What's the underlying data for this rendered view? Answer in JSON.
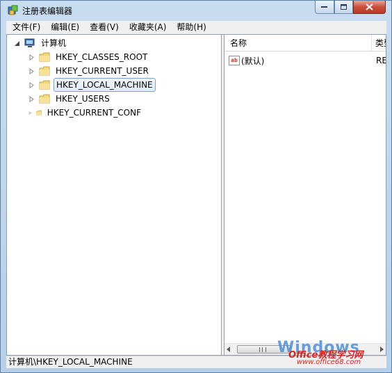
{
  "window": {
    "title": "注册表编辑器",
    "accent": "#c9dcf0",
    "close_color": "#c9503b"
  },
  "menu": [
    {
      "label": "文件(F)"
    },
    {
      "label": "编辑(E)"
    },
    {
      "label": "查看(V)"
    },
    {
      "label": "收藏夹(A)"
    },
    {
      "label": "帮助(H)"
    }
  ],
  "tree": {
    "root": {
      "label": "计算机",
      "icon": "computer-icon",
      "expanded": true
    },
    "items": [
      {
        "label": "HKEY_CLASSES_ROOT",
        "icon": "folder-icon",
        "selected": false
      },
      {
        "label": "HKEY_CURRENT_USER",
        "icon": "folder-icon",
        "selected": false
      },
      {
        "label": "HKEY_LOCAL_MACHINE",
        "icon": "folder-icon",
        "selected": true
      },
      {
        "label": "HKEY_USERS",
        "icon": "folder-icon",
        "selected": false
      },
      {
        "label": "HKEY_CURRENT_CONF",
        "icon": "folder-icon",
        "selected": false
      }
    ]
  },
  "list": {
    "columns": [
      {
        "label": "名称"
      },
      {
        "label": "类型"
      }
    ],
    "rows": [
      {
        "name": "(默认)",
        "type": "RE",
        "icon": "string-value-icon"
      }
    ]
  },
  "status": {
    "path": "计算机\\HKEY_LOCAL_MACHINE"
  },
  "watermark": {
    "brand": "Windows",
    "line1": "Office教程学习网",
    "line2": "www.office68.com"
  }
}
